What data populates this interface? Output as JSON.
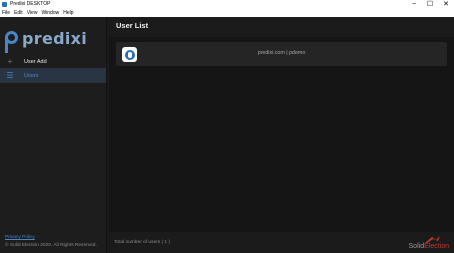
{
  "window": {
    "title": "Predixi DESKTOP",
    "minimize": "−",
    "maximize": "☐",
    "close": "✕"
  },
  "menu": [
    "File",
    "Edit",
    "View",
    "Window",
    "Help"
  ],
  "sidebar": {
    "logo_text": "predixi",
    "items": [
      {
        "label": "User Add",
        "icon": "plus-icon",
        "glyph": "+",
        "active": false
      },
      {
        "label": "Users",
        "icon": "list-icon",
        "glyph": "☰",
        "active": true
      }
    ],
    "privacy_link": "Privacy Policy",
    "copyright": "© Solid Election 2020. All Rights Reserved."
  },
  "main": {
    "title": "User List",
    "users": [
      {
        "text": "predixi.com | pdemo",
        "avatar_icon": "predixi-app-icon"
      }
    ],
    "footer_count": "Total number of users ( 1 )"
  },
  "brand": {
    "name_part1": "Solid",
    "name_part2": "Election"
  },
  "colors": {
    "accent": "#4a86c5",
    "active_bg": "#2a3544",
    "background": "#1b1b1b",
    "brand_red": "#c0392b"
  }
}
